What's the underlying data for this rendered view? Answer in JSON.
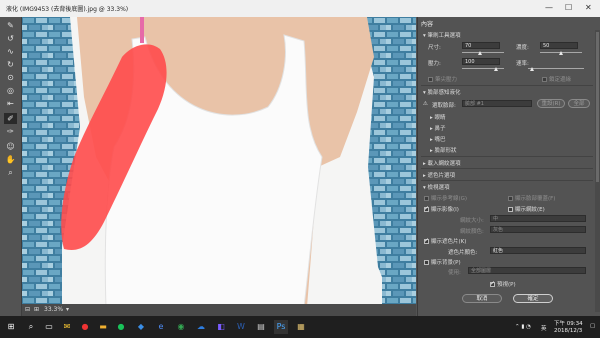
{
  "window": {
    "title": "液化 (IMG9453 (去背後底圖).jpg @ 33.3%)",
    "min": "—",
    "max": "☐",
    "close": "✕"
  },
  "status": {
    "zoom": "33.3%"
  },
  "panel": {
    "title": "內容",
    "brush_section": "筆刷工具選項",
    "size_label": "尺寸:",
    "size_value": "70",
    "density_label": "濃度:",
    "density_value": "50",
    "pressure_label": "壓力:",
    "pressure_value": "100",
    "rate_label": "速率:",
    "stylus_pressure": "筆尖壓力",
    "pin_edges": "鎖定邊緣",
    "face_section": "臉部感知液化",
    "select_face_label": "選取臉部:",
    "select_face_value": "臉部 #1",
    "reset_label": "重設(R)",
    "all_label": "全部",
    "face_items": [
      "眼睛",
      "鼻子",
      "嘴巴",
      "臉部形狀"
    ],
    "load_mesh": "載入網紋選項",
    "mask_options": "遮色片選項",
    "view_options": "檢視選項",
    "show_guides": "顯示參考線(G)",
    "show_face_overlay": "顯示臉部覆蓋(F)",
    "show_image": "顯示影像(I)",
    "show_mesh": "顯示網紋(E)",
    "mesh_size_label": "網紋大小:",
    "mesh_size_value": "中",
    "mesh_color_label": "網紋顏色:",
    "mesh_color_value": "灰色",
    "show_mask": "顯示遮色片(K)",
    "mask_color_label": "遮色片顏色:",
    "mask_color_value": "紅色",
    "show_backdrop": "顯示背景(P)",
    "use_label": "使用:",
    "use_value": "全部圖層",
    "preview": "預視(P)",
    "cancel": "取消",
    "ok": "確定"
  },
  "taskbar": {
    "time": "下午 09:34",
    "date": "2018/12/3",
    "lang": "英"
  },
  "colors": {
    "mask": "#ff4b4b",
    "brick": "#3f7ea0",
    "panel": "#535353"
  }
}
